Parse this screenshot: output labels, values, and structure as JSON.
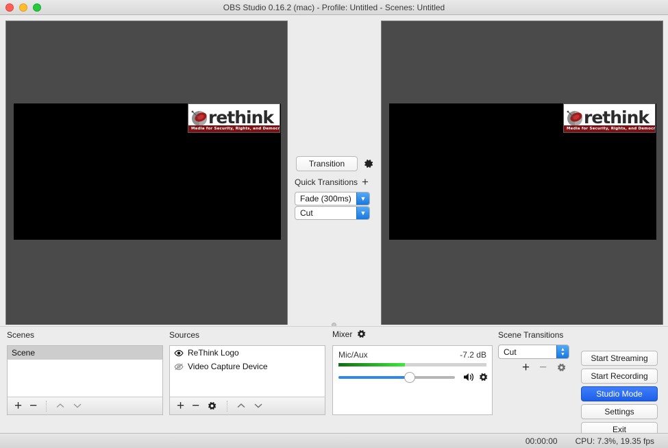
{
  "window": {
    "title": "OBS Studio 0.16.2 (mac) - Profile: Untitled - Scenes: Untitled",
    "traffic_lights": [
      "close-red",
      "minimize-yellow",
      "zoom-green"
    ]
  },
  "preview": {
    "logo": {
      "word": "rethink",
      "tagline": "Media for Security, Rights, and Democracy"
    }
  },
  "center": {
    "transition_button": "Transition",
    "transition_gear_icon": "gear-icon",
    "quick_transitions_label": "Quick Transitions",
    "quick_add_icon": "plus-icon",
    "quick_transitions": [
      {
        "label": "Fade (300ms)"
      },
      {
        "label": "Cut"
      }
    ]
  },
  "scenes": {
    "title": "Scenes",
    "items": [
      {
        "label": "Scene",
        "selected": true
      }
    ],
    "toolbar": {
      "add": "+",
      "remove": "−",
      "move_up": "⌃",
      "move_down": "⌄"
    }
  },
  "sources": {
    "title": "Sources",
    "items": [
      {
        "label": "ReThink Logo",
        "visible": true,
        "icon": "eye-visible-icon"
      },
      {
        "label": "Video Capture Device",
        "visible": false,
        "icon": "eye-hidden-icon"
      }
    ],
    "toolbar": {
      "add": "+",
      "remove": "−",
      "properties": "gear-icon",
      "move_up": "⌃",
      "move_down": "⌄"
    }
  },
  "mixer": {
    "title": "Mixer",
    "gear_icon": "gear-icon",
    "channels": [
      {
        "name": "Mic/Aux",
        "level": "-7.2 dB",
        "meter_percent": 45,
        "volume_percent": 61,
        "mute_icon": "speaker-icon",
        "settings_icon": "gear-icon"
      }
    ]
  },
  "scene_transitions": {
    "title": "Scene Transitions",
    "selected": "Cut",
    "toolbar": {
      "add": "+",
      "remove": "−",
      "properties": "gear-icon"
    }
  },
  "controls": {
    "buttons": [
      {
        "label": "Start Streaming",
        "primary": false
      },
      {
        "label": "Start Recording",
        "primary": false
      },
      {
        "label": "Studio Mode",
        "primary": true
      },
      {
        "label": "Settings",
        "primary": false
      },
      {
        "label": "Exit",
        "primary": false
      }
    ]
  },
  "statusbar": {
    "timecode": "00:00:00",
    "performance": "CPU: 7.3%, 19.35 fps"
  },
  "colors": {
    "accent_blue": "#1d5fe8",
    "meter_green": "#3ee83e",
    "preview_bg": "#4a4a4a",
    "chrome_bg": "#ececec"
  }
}
